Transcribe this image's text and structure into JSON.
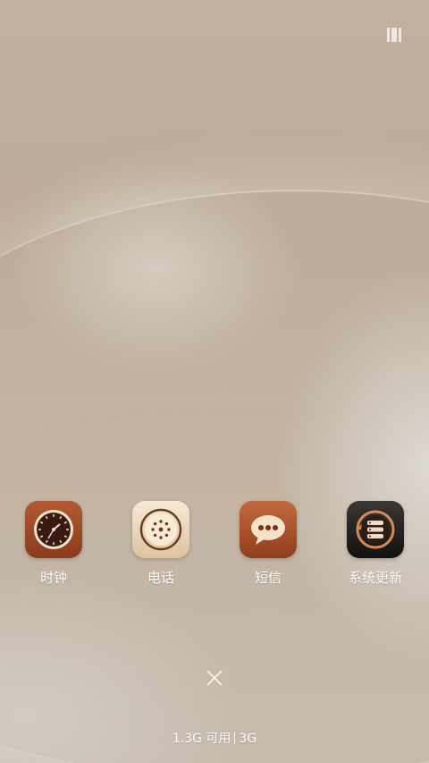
{
  "apps": [
    {
      "label": "时钟",
      "icon": "clock-icon"
    },
    {
      "label": "电话",
      "icon": "phone-dial-icon"
    },
    {
      "label": "短信",
      "icon": "message-bubble-icon"
    },
    {
      "label": "系统更新",
      "icon": "system-update-icon"
    }
  ],
  "corner_button": {
    "icon": "layout-icon"
  },
  "close_button": {
    "icon": "close-icon"
  },
  "storage": {
    "available": "1.3G 可用",
    "network": "3G"
  },
  "colors": {
    "label_text": "#ffffff",
    "wallpaper": "#c2b3a0",
    "clock_icon": "#9b4726",
    "phone_icon": "#ead7bd",
    "sms_icon": "#a84e27",
    "update_icon": "#242220"
  }
}
